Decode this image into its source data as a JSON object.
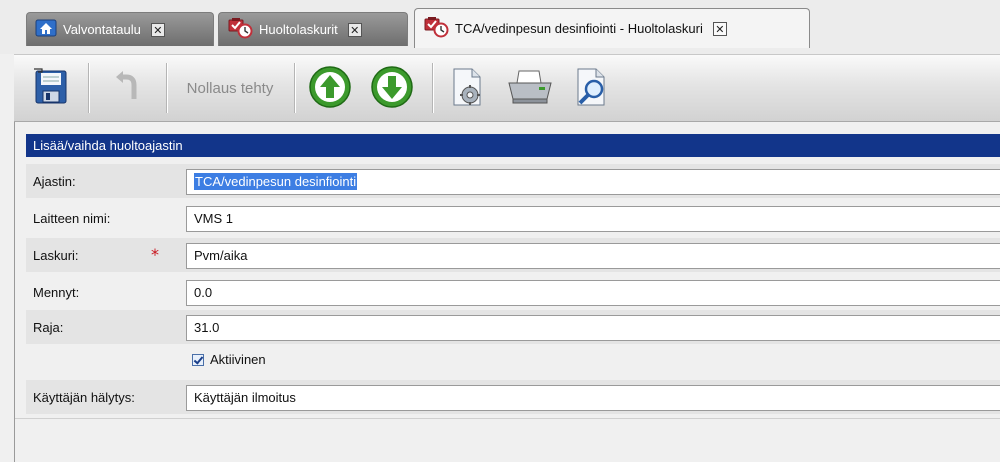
{
  "tabs": [
    {
      "label": "Valvontataulu",
      "icon": "home-icon",
      "active": false
    },
    {
      "label": "Huoltolaskurit",
      "icon": "maintenance-counter-icon",
      "active": false
    },
    {
      "label": "TCA/vedinpesun desinfiointi - Huoltolaskuri",
      "icon": "maintenance-counter-icon",
      "active": true
    }
  ],
  "tab_close_glyph": "✕",
  "toolbar": {
    "save_icon": "save-icon",
    "undo_icon": "undo-icon",
    "reset_label": "Nollaus tehty",
    "up_icon": "arrow-up-icon",
    "down_icon": "arrow-down-icon",
    "settings_icon": "document-settings-icon",
    "print_icon": "printer-icon",
    "preview_icon": "print-preview-icon"
  },
  "form": {
    "header": "Lisää/vaihda huoltoajastin",
    "fields": {
      "ajastin": {
        "label": "Ajastin:",
        "value": "TCA/vedinpesun desinfiointi"
      },
      "laite": {
        "label": "Laitteen nimi:",
        "value": "VMS 1"
      },
      "laskuri": {
        "label": "Laskuri:",
        "value": "Pvm/aika",
        "required_mark": "*"
      },
      "mennyt": {
        "label": "Mennyt:",
        "value": "0.0"
      },
      "raja": {
        "label": "Raja:",
        "value": "31.0"
      },
      "aktiivinen": {
        "label": "Aktiivinen",
        "checked": true
      },
      "halytys": {
        "label": "Käyttäjän hälytys:",
        "value": "Käyttäjän ilmoitus"
      }
    }
  },
  "colors": {
    "header_bg": "#12358a",
    "selection": "#3d7ee3",
    "required": "#c8141c",
    "arrow_green": "#3c9a2c"
  }
}
